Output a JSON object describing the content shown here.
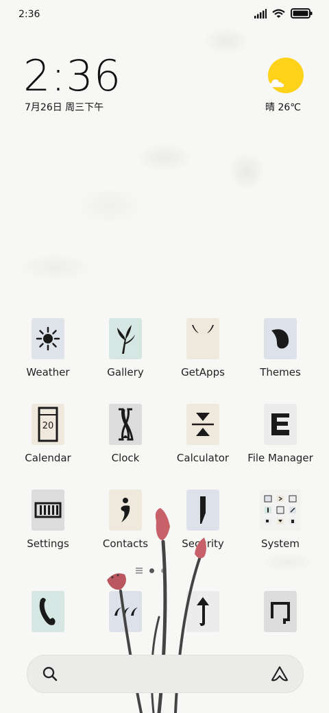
{
  "status_bar": {
    "time": "2:36"
  },
  "clock_widget": {
    "time": "2:36",
    "date": "7月26日 周三下午"
  },
  "weather_widget": {
    "text": "晴 26℃"
  },
  "apps": [
    {
      "label": "Weather",
      "icon": "sun-icon",
      "bg": "#dfe3ea"
    },
    {
      "label": "Gallery",
      "icon": "plant-icon",
      "bg": "#d6e7e3"
    },
    {
      "label": "GetApps",
      "icon": "bag-smile-icon",
      "bg": "#efe8dd"
    },
    {
      "label": "Themes",
      "icon": "leaf-drop-icon",
      "bg": "#dde2ea"
    },
    {
      "label": "Calendar",
      "icon": "calendar-icon",
      "bg": "#efe8dd",
      "day": "20"
    },
    {
      "label": "Clock",
      "icon": "hourglass-icon",
      "bg": "#dcdcdc"
    },
    {
      "label": "Calculator",
      "icon": "calculator-icon",
      "bg": "#efe8dd"
    },
    {
      "label": "File Manager",
      "icon": "file-stack-icon",
      "bg": "#ececec"
    },
    {
      "label": "Settings",
      "icon": "settings-grid-icon",
      "bg": "#dcdcdc"
    },
    {
      "label": "Contacts",
      "icon": "contact-drop-icon",
      "bg": "#efe8dd"
    },
    {
      "label": "Security",
      "icon": "shield-bar-icon",
      "bg": "#dde2ea"
    },
    {
      "label": "System",
      "icon": "folder-icon",
      "bg": "#f2f2f0"
    }
  ],
  "dock": [
    {
      "name": "phone",
      "icon": "phone-icon",
      "bg": "#d6e7e3"
    },
    {
      "name": "messages",
      "icon": "messages-icon",
      "bg": "#dde2ea"
    },
    {
      "name": "browser",
      "icon": "arrow-up-icon",
      "bg": "#ececec"
    },
    {
      "name": "camera",
      "icon": "camera-frame-icon",
      "bg": "#dcdcdc"
    }
  ],
  "colors": {
    "sun": "#ffd21a",
    "lotus": "#c8606a",
    "stem": "#444444"
  }
}
